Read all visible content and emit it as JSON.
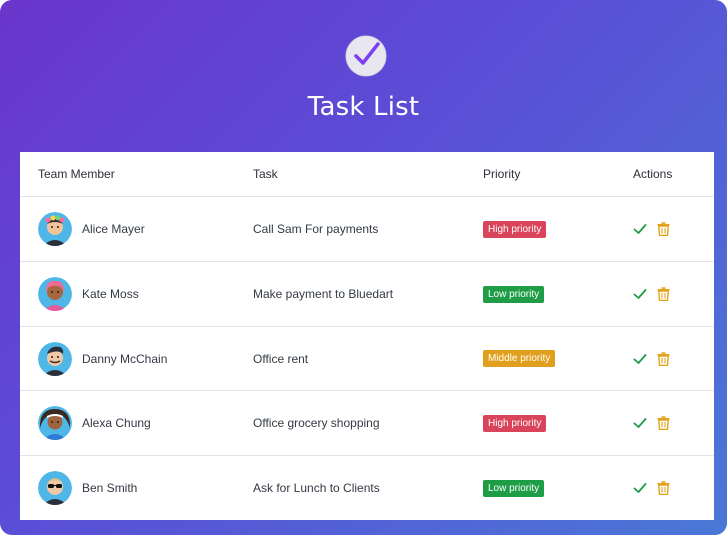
{
  "app": {
    "title": "Task List",
    "logo_icon": "check-circle-icon"
  },
  "table": {
    "headers": {
      "member": "Team Member",
      "task": "Task",
      "priority": "Priority",
      "actions": "Actions"
    },
    "rows": [
      {
        "member": "Alice Mayer",
        "task": "Call Sam For payments",
        "priority": "High priority",
        "priority_color": "#d9445a"
      },
      {
        "member": "Kate Moss",
        "task": "Make payment to Bluedart",
        "priority": "Low priority",
        "priority_color": "#1e9d46"
      },
      {
        "member": "Danny McChain",
        "task": "Office rent",
        "priority": "Middle priority",
        "priority_color": "#e0a01e"
      },
      {
        "member": "Alexa Chung",
        "task": "Office grocery shopping",
        "priority": "High priority",
        "priority_color": "#d9445a"
      },
      {
        "member": "Ben Smith",
        "task": "Ask for Lunch to Clients",
        "priority": "Low priority",
        "priority_color": "#1e9d46"
      }
    ],
    "action_icons": {
      "complete": "checkmark-icon",
      "delete": "trash-icon"
    }
  },
  "colors": {
    "check": "#1e9d46",
    "trash": "#e3a21a",
    "gradient_start": "#6a35cc",
    "gradient_end": "#4a78d6"
  }
}
